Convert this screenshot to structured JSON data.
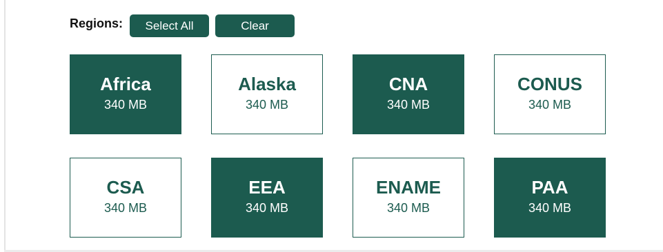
{
  "toolbar": {
    "label": "Regions:",
    "select_all_label": "Select All",
    "clear_label": "Clear"
  },
  "regions": [
    {
      "name": "Africa",
      "size": "340 MB",
      "selected": true
    },
    {
      "name": "Alaska",
      "size": "340 MB",
      "selected": false
    },
    {
      "name": "CNA",
      "size": "340 MB",
      "selected": true
    },
    {
      "name": "CONUS",
      "size": "340 MB",
      "selected": false
    },
    {
      "name": "CSA",
      "size": "340 MB",
      "selected": false
    },
    {
      "name": "EEA",
      "size": "340 MB",
      "selected": true
    },
    {
      "name": "ENAME",
      "size": "340 MB",
      "selected": false
    },
    {
      "name": "PAA",
      "size": "340 MB",
      "selected": true
    }
  ],
  "colors": {
    "accent": "#1c5b4f",
    "tile_unselected_bg": "#ffffff",
    "tile_selected_text": "#ffffff"
  }
}
